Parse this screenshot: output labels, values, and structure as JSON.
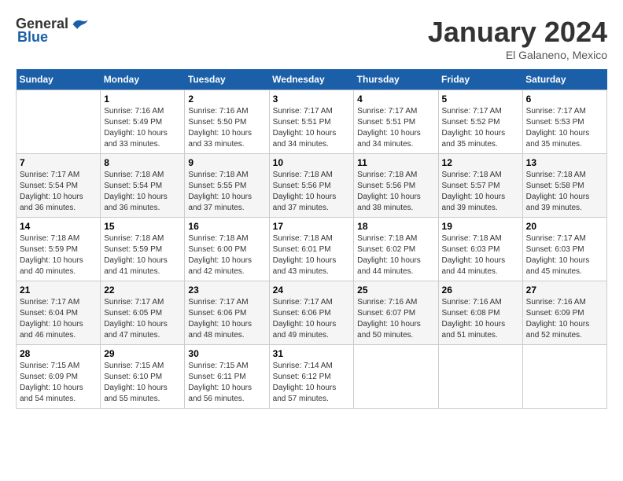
{
  "logo": {
    "general": "General",
    "blue": "Blue"
  },
  "title": "January 2024",
  "location": "El Galaneno, Mexico",
  "days_header": [
    "Sunday",
    "Monday",
    "Tuesday",
    "Wednesday",
    "Thursday",
    "Friday",
    "Saturday"
  ],
  "weeks": [
    [
      {
        "day": "",
        "info": ""
      },
      {
        "day": "1",
        "info": "Sunrise: 7:16 AM\nSunset: 5:49 PM\nDaylight: 10 hours\nand 33 minutes."
      },
      {
        "day": "2",
        "info": "Sunrise: 7:16 AM\nSunset: 5:50 PM\nDaylight: 10 hours\nand 33 minutes."
      },
      {
        "day": "3",
        "info": "Sunrise: 7:17 AM\nSunset: 5:51 PM\nDaylight: 10 hours\nand 34 minutes."
      },
      {
        "day": "4",
        "info": "Sunrise: 7:17 AM\nSunset: 5:51 PM\nDaylight: 10 hours\nand 34 minutes."
      },
      {
        "day": "5",
        "info": "Sunrise: 7:17 AM\nSunset: 5:52 PM\nDaylight: 10 hours\nand 35 minutes."
      },
      {
        "day": "6",
        "info": "Sunrise: 7:17 AM\nSunset: 5:53 PM\nDaylight: 10 hours\nand 35 minutes."
      }
    ],
    [
      {
        "day": "7",
        "info": "Sunrise: 7:17 AM\nSunset: 5:54 PM\nDaylight: 10 hours\nand 36 minutes."
      },
      {
        "day": "8",
        "info": "Sunrise: 7:18 AM\nSunset: 5:54 PM\nDaylight: 10 hours\nand 36 minutes."
      },
      {
        "day": "9",
        "info": "Sunrise: 7:18 AM\nSunset: 5:55 PM\nDaylight: 10 hours\nand 37 minutes."
      },
      {
        "day": "10",
        "info": "Sunrise: 7:18 AM\nSunset: 5:56 PM\nDaylight: 10 hours\nand 37 minutes."
      },
      {
        "day": "11",
        "info": "Sunrise: 7:18 AM\nSunset: 5:56 PM\nDaylight: 10 hours\nand 38 minutes."
      },
      {
        "day": "12",
        "info": "Sunrise: 7:18 AM\nSunset: 5:57 PM\nDaylight: 10 hours\nand 39 minutes."
      },
      {
        "day": "13",
        "info": "Sunrise: 7:18 AM\nSunset: 5:58 PM\nDaylight: 10 hours\nand 39 minutes."
      }
    ],
    [
      {
        "day": "14",
        "info": "Sunrise: 7:18 AM\nSunset: 5:59 PM\nDaylight: 10 hours\nand 40 minutes."
      },
      {
        "day": "15",
        "info": "Sunrise: 7:18 AM\nSunset: 5:59 PM\nDaylight: 10 hours\nand 41 minutes."
      },
      {
        "day": "16",
        "info": "Sunrise: 7:18 AM\nSunset: 6:00 PM\nDaylight: 10 hours\nand 42 minutes."
      },
      {
        "day": "17",
        "info": "Sunrise: 7:18 AM\nSunset: 6:01 PM\nDaylight: 10 hours\nand 43 minutes."
      },
      {
        "day": "18",
        "info": "Sunrise: 7:18 AM\nSunset: 6:02 PM\nDaylight: 10 hours\nand 44 minutes."
      },
      {
        "day": "19",
        "info": "Sunrise: 7:18 AM\nSunset: 6:03 PM\nDaylight: 10 hours\nand 44 minutes."
      },
      {
        "day": "20",
        "info": "Sunrise: 7:17 AM\nSunset: 6:03 PM\nDaylight: 10 hours\nand 45 minutes."
      }
    ],
    [
      {
        "day": "21",
        "info": "Sunrise: 7:17 AM\nSunset: 6:04 PM\nDaylight: 10 hours\nand 46 minutes."
      },
      {
        "day": "22",
        "info": "Sunrise: 7:17 AM\nSunset: 6:05 PM\nDaylight: 10 hours\nand 47 minutes."
      },
      {
        "day": "23",
        "info": "Sunrise: 7:17 AM\nSunset: 6:06 PM\nDaylight: 10 hours\nand 48 minutes."
      },
      {
        "day": "24",
        "info": "Sunrise: 7:17 AM\nSunset: 6:06 PM\nDaylight: 10 hours\nand 49 minutes."
      },
      {
        "day": "25",
        "info": "Sunrise: 7:16 AM\nSunset: 6:07 PM\nDaylight: 10 hours\nand 50 minutes."
      },
      {
        "day": "26",
        "info": "Sunrise: 7:16 AM\nSunset: 6:08 PM\nDaylight: 10 hours\nand 51 minutes."
      },
      {
        "day": "27",
        "info": "Sunrise: 7:16 AM\nSunset: 6:09 PM\nDaylight: 10 hours\nand 52 minutes."
      }
    ],
    [
      {
        "day": "28",
        "info": "Sunrise: 7:15 AM\nSunset: 6:09 PM\nDaylight: 10 hours\nand 54 minutes."
      },
      {
        "day": "29",
        "info": "Sunrise: 7:15 AM\nSunset: 6:10 PM\nDaylight: 10 hours\nand 55 minutes."
      },
      {
        "day": "30",
        "info": "Sunrise: 7:15 AM\nSunset: 6:11 PM\nDaylight: 10 hours\nand 56 minutes."
      },
      {
        "day": "31",
        "info": "Sunrise: 7:14 AM\nSunset: 6:12 PM\nDaylight: 10 hours\nand 57 minutes."
      },
      {
        "day": "",
        "info": ""
      },
      {
        "day": "",
        "info": ""
      },
      {
        "day": "",
        "info": ""
      }
    ]
  ]
}
